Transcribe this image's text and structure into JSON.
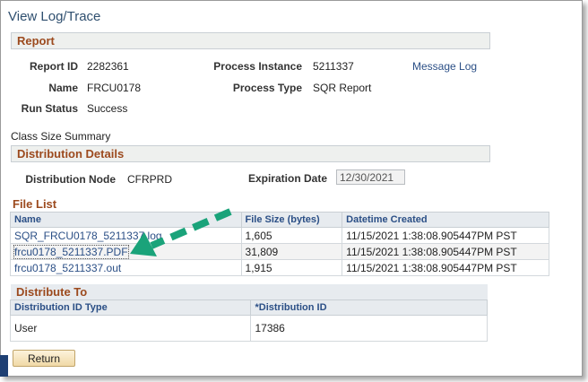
{
  "page": {
    "title": "View Log/Trace"
  },
  "report": {
    "header": "Report",
    "report_id_label": "Report ID",
    "report_id": "2282361",
    "process_instance_label": "Process Instance",
    "process_instance": "5211337",
    "message_log_link": "Message Log",
    "name_label": "Name",
    "name": "FRCU0178",
    "process_type_label": "Process Type",
    "process_type": "SQR Report",
    "run_status_label": "Run Status",
    "run_status": "Success"
  },
  "summary_text": "Class Size Summary",
  "distribution": {
    "header": "Distribution Details",
    "node_label": "Distribution Node",
    "node": "CFRPRD",
    "expiration_label": "Expiration Date",
    "expiration": "12/30/2021"
  },
  "file_list": {
    "title": "File List",
    "columns": [
      "Name",
      "File Size (bytes)",
      "Datetime Created"
    ],
    "rows": [
      {
        "name": "SQR_FRCU0178_5211337.log",
        "size": "1,605",
        "created": "11/15/2021  1:38:08.905447PM PST"
      },
      {
        "name": "frcu0178_5211337.PDF",
        "size": "31,809",
        "created": "11/15/2021  1:38:08.905447PM PST"
      },
      {
        "name": "frcu0178_5211337.out",
        "size": "1,915",
        "created": "11/15/2021  1:38:08.905447PM PST"
      }
    ]
  },
  "distribute_to": {
    "title": "Distribute To",
    "columns": [
      "Distribution ID Type",
      "*Distribution ID"
    ],
    "rows": [
      {
        "type": "User",
        "id": "17386"
      }
    ]
  },
  "buttons": {
    "return_label": "Return"
  },
  "colors": {
    "section_text": "#9c4a1e",
    "link": "#2b4f86",
    "annotation_arrow": "#1aa37a",
    "corner_mark": "#1e3f73"
  }
}
